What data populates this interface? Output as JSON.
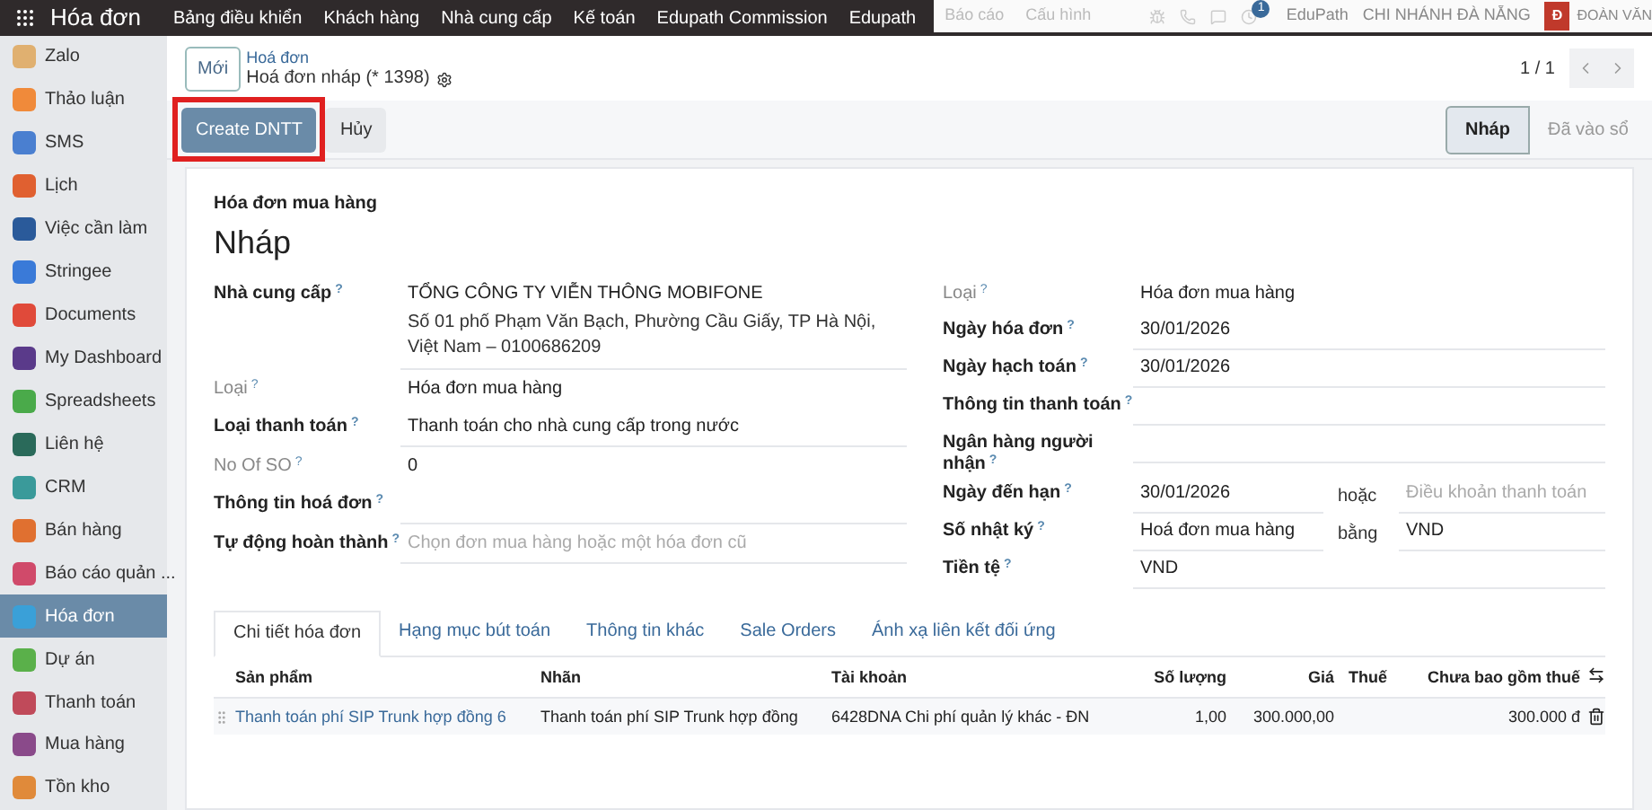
{
  "top_bar": {
    "app_title": "Hóa đơn",
    "menu": [
      "Bảng điều khiển",
      "Khách hàng",
      "Nhà cung cấp",
      "Kế toán",
      "Edupath Commission",
      "Edupath"
    ],
    "faded_menu": [
      "Báo cáo",
      "Cấu hình"
    ],
    "notification_count": "1",
    "company": "EduPath",
    "branch": "CHI NHÁNH ĐÀ NẴNG",
    "avatar": "Đ",
    "user": "ĐOÀN VĂN"
  },
  "sidebar": {
    "items": [
      {
        "label": "Zalo",
        "color": "#e0b070",
        "selected": false
      },
      {
        "label": "Thảo luận",
        "color": "#f08a3a",
        "selected": false
      },
      {
        "label": "SMS",
        "color": "#4a7fd0",
        "selected": false
      },
      {
        "label": "Lịch",
        "color": "#e06030",
        "selected": false
      },
      {
        "label": "Việc cần làm",
        "color": "#2a5a9a",
        "selected": false
      },
      {
        "label": "Stringee",
        "color": "#3a7ad8",
        "selected": false
      },
      {
        "label": "Documents",
        "color": "#e04a3a",
        "selected": false
      },
      {
        "label": "My Dashboard",
        "color": "#5a3a8a",
        "selected": false
      },
      {
        "label": "Spreadsheets",
        "color": "#4aaa4a",
        "selected": false
      },
      {
        "label": "Liên hệ",
        "color": "#2a6a5a",
        "selected": false
      },
      {
        "label": "CRM",
        "color": "#3a9a9a",
        "selected": false
      },
      {
        "label": "Bán hàng",
        "color": "#e07030",
        "selected": false
      },
      {
        "label": "Báo cáo quản ...",
        "color": "#d04a6a",
        "selected": false
      },
      {
        "label": "Hóa đơn",
        "color": "#3aa0d8",
        "selected": true
      },
      {
        "label": "Dự án",
        "color": "#5ab04a",
        "selected": false
      },
      {
        "label": "Thanh toán",
        "color": "#c04a5a",
        "selected": false
      },
      {
        "label": "Mua hàng",
        "color": "#8a4a8a",
        "selected": false
      },
      {
        "label": "Tồn kho",
        "color": "#e08a3a",
        "selected": false
      }
    ]
  },
  "control_panel": {
    "new_button": "Mới",
    "breadcrumb": "Hoá đơn",
    "record_title": "Hoá đơn nháp (* 1398)",
    "pager": "1 / 1"
  },
  "actions": [
    {
      "label": "Create DNTT",
      "kind": "primary",
      "highlighted": true
    },
    {
      "label": "Hủy",
      "kind": "secondary",
      "highlighted": false
    }
  ],
  "status_steps": [
    {
      "label": "Nháp",
      "selected": true
    },
    {
      "label": "Đã vào sổ",
      "selected": false
    }
  ],
  "sheet": {
    "subtitle": "Hóa đơn mua hàng",
    "title": "Nháp",
    "left_fields": [
      {
        "label": "Nhà cung cấp",
        "help": "?",
        "bold": true,
        "value": "TỔNG CÔNG TY VIỄN THÔNG MOBIFONE",
        "address": "Số 01 phố Phạm Văn Bạch, Phường Cầu Giấy, TP Hà Nội, Việt Nam – 0100686209",
        "underline": true
      },
      {
        "label": "Loại",
        "help": "?",
        "bold": false,
        "value": "Hóa đơn mua hàng",
        "underline": false
      },
      {
        "label": "Loại thanh toán",
        "help": "?",
        "bold": true,
        "value": "Thanh toán cho nhà cung cấp trong nước",
        "underline": true
      },
      {
        "label": "No Of SO",
        "help": "?",
        "bold": false,
        "value": "0",
        "underline": false
      },
      {
        "label": "Thông tin hoá đơn",
        "help": "?",
        "bold": true,
        "underline": true
      },
      {
        "label": "Tự động hoàn thành",
        "help": "?",
        "bold": true,
        "placeholder": "Chọn đơn mua hàng hoặc một hóa đơn cũ",
        "underline": true
      }
    ],
    "right_fields": [
      {
        "label": "Loại",
        "help": "?",
        "bold": false,
        "value": "Hóa đơn mua hàng",
        "underline": false
      },
      {
        "label": "Ngày hóa đơn",
        "help": "?",
        "bold": true,
        "value": "30/01/2026",
        "underline": true
      },
      {
        "label": "Ngày hạch toán",
        "help": "?",
        "bold": true,
        "value": "30/01/2026",
        "underline": true
      },
      {
        "label": "Thông tin thanh toán",
        "help": "?",
        "bold": true,
        "underline": true
      },
      {
        "label": "Ngân hàng người nhận",
        "help": "?",
        "bold": true,
        "underline": true
      },
      {
        "label": "Ngày đến hạn",
        "help": "?",
        "bold": true,
        "value": "30/01/2026",
        "underline": true,
        "extra_label": "hoặc",
        "extra_placeholder": "Điều khoản thanh toán"
      },
      {
        "label": "Số nhật ký",
        "help": "?",
        "bold": true,
        "value": "Hoá đơn mua hàng",
        "underline": true,
        "extra_label": "bằng",
        "extra_value": "VND"
      },
      {
        "label": "Tiền tệ",
        "help": "?",
        "bold": true,
        "value": "VND",
        "underline": true
      }
    ],
    "tabs": [
      {
        "label": "Chi tiết hóa đơn",
        "selected": true
      },
      {
        "label": "Hạng mục bút toán",
        "selected": false
      },
      {
        "label": "Thông tin khác",
        "selected": false
      },
      {
        "label": "Sale Orders",
        "selected": false
      },
      {
        "label": "Ánh xạ liên kết đối ứng",
        "selected": false
      }
    ],
    "table": {
      "columns": [
        "Sản phẩm",
        "Nhãn",
        "Tài khoản",
        "Số lượng",
        "Giá",
        "Thuế",
        "Chưa bao gồm thuế"
      ],
      "rows": [
        {
          "product": "Thanh toán phí SIP Trunk hợp đồng 6",
          "label": "Thanh toán phí SIP Trunk  hợp đồng",
          "account": "6428DNA Chi phí quản lý khác - ĐN",
          "quantity": "1,00",
          "price": "300.000,00",
          "subtotal": "300.000 đ"
        }
      ]
    }
  }
}
